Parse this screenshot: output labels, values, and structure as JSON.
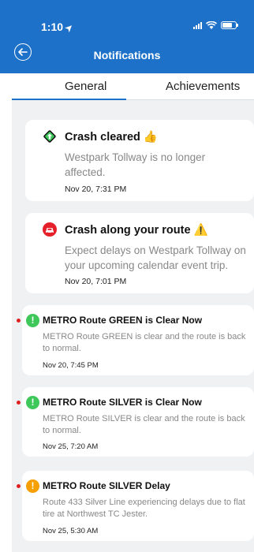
{
  "status_bar": {
    "time": "1:10"
  },
  "header": {
    "title": "Notifications",
    "back_icon": "back-arrow-icon"
  },
  "tabs": [
    {
      "label": "General",
      "selected": true
    },
    {
      "label": "Achievements",
      "selected": false
    }
  ],
  "notifications": [
    {
      "icon": "traffic-cleared-icon",
      "title": "Crash cleared",
      "emoji": "👍",
      "message": "Westpark Tollway is no longer affected.",
      "time": "Nov 20, 7:31 PM",
      "unread": false
    },
    {
      "icon": "car-crash-icon",
      "title": "Crash along your route",
      "emoji": "⚠️",
      "message": "Expect delays on Westpark Tollway on your upcoming calendar event trip.",
      "time": "Nov 20, 7:01 PM",
      "unread": false
    },
    {
      "icon": "info-green-icon",
      "badge": "!",
      "title": "METRO Route GREEN is Clear Now",
      "message": "METRO Route GREEN is clear and the route is back to normal.",
      "time": "Nov 20, 7:45 PM",
      "unread": true
    },
    {
      "icon": "info-green-icon",
      "badge": "!",
      "title": "METRO Route SILVER is Clear Now",
      "message": "METRO Route SILVER is clear and the route is back to normal.",
      "time": "Nov 25, 7:20 AM",
      "unread": true
    },
    {
      "icon": "warning-orange-icon",
      "badge": "!",
      "title": "METRO Route SILVER Delay",
      "message": "Route 433 Silver Line experiencing delays due to flat tire at Northwest TC Jester.",
      "time": "Nov 25, 5:30 AM",
      "unread": true
    }
  ],
  "colors": {
    "header": "#1e71c9",
    "accent_green": "#3ec85a",
    "accent_orange": "#f5a000",
    "unread_dot": "#e02020",
    "crash_red": "#e5202a"
  }
}
